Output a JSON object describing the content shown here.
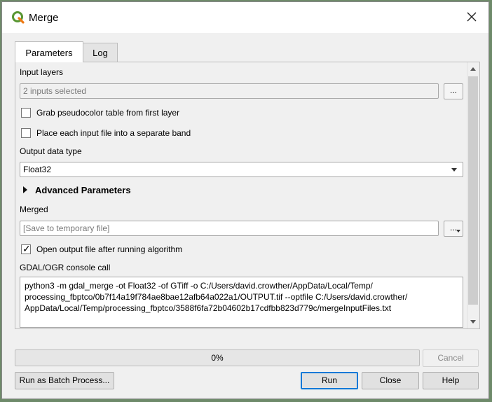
{
  "window": {
    "title": "Merge",
    "app_icon": "qgis-logo-icon",
    "close_icon": "close-icon"
  },
  "tabs": [
    {
      "label": "Parameters",
      "active": true
    },
    {
      "label": "Log",
      "active": false
    }
  ],
  "params": {
    "input_layers_label": "Input layers",
    "input_layers_value": "2 inputs selected",
    "browse_label": "...",
    "grab_pseudocolor_label": "Grab pseudocolor table from first layer",
    "grab_pseudocolor_checked": false,
    "separate_band_label": "Place each input file into a separate band",
    "separate_band_checked": false,
    "output_type_label": "Output data type",
    "output_type_value": "Float32",
    "advanced_label": "Advanced Parameters",
    "merged_label": "Merged",
    "merged_placeholder": "[Save to temporary file]",
    "merged_browse_label": "...",
    "open_output_label": "Open output file after running algorithm",
    "open_output_checked": true,
    "console_label": "GDAL/OGR console call",
    "console_text": "python3 -m gdal_merge -ot Float32 -of GTiff -o C:/Users/david.crowther/AppData/Local/Temp/\nprocessing_fbptco/0b7f14a19f784ae8bae12afb64a022a1/OUTPUT.tif --optfile C:/Users/david.crowther/\nAppData/Local/Temp/processing_fbptco/3588f6fa72b04602b17cdfbb823d779c/mergeInputFiles.txt"
  },
  "progress": {
    "value": 0,
    "text": "0%"
  },
  "buttons": {
    "cancel": "Cancel",
    "batch": "Run as Batch Process...",
    "run": "Run",
    "close": "Close",
    "help": "Help"
  },
  "colors": {
    "qgis_green": "#589632",
    "qgis_yellow": "#ee7913",
    "default_button_border": "#0078d7"
  }
}
